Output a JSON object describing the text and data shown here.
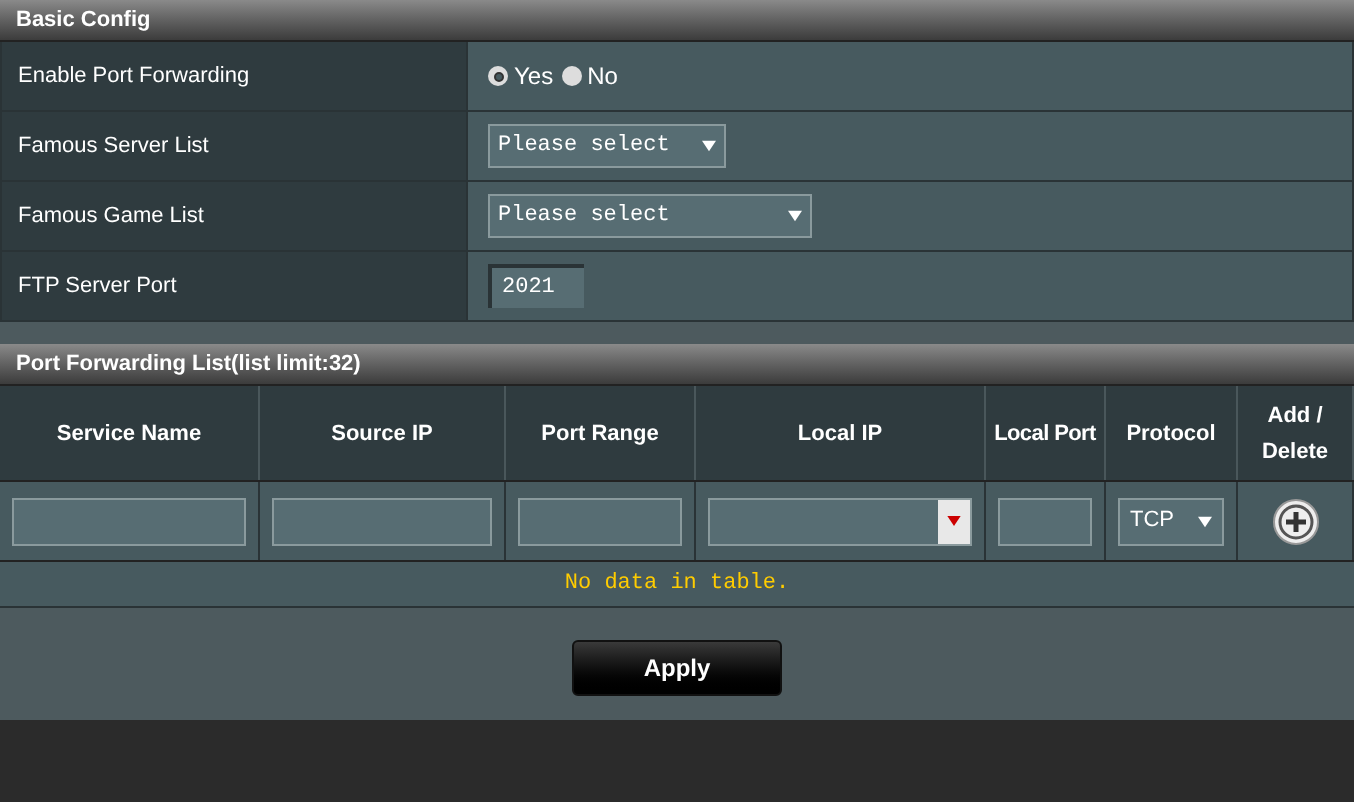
{
  "basic_config": {
    "title": "Basic Config",
    "rows": [
      {
        "kind": "radio",
        "label": "Enable Port Forwarding",
        "options": [
          {
            "label": "Yes",
            "selected": true
          },
          {
            "label": "No",
            "selected": false
          }
        ]
      },
      {
        "kind": "select",
        "label": "Famous Server List",
        "value": "Please select",
        "wide": false
      },
      {
        "kind": "select",
        "label": "Famous Game List",
        "value": "Please select",
        "wide": true
      },
      {
        "kind": "text",
        "label": "FTP Server Port",
        "value": "2021"
      }
    ]
  },
  "port_forwarding_list": {
    "title": "Port Forwarding List(list limit:32)",
    "columns": [
      "Service Name",
      "Source IP",
      "Port Range",
      "Local IP",
      "Local Port",
      "Protocol",
      "Add / Delete"
    ],
    "input_row": [
      {
        "kind": "text"
      },
      {
        "kind": "text"
      },
      {
        "kind": "text"
      },
      {
        "kind": "combo"
      },
      {
        "kind": "text"
      },
      {
        "kind": "select",
        "value": "TCP"
      },
      {
        "kind": "add"
      }
    ],
    "empty_message": "No data in table."
  },
  "apply_button": "Apply"
}
